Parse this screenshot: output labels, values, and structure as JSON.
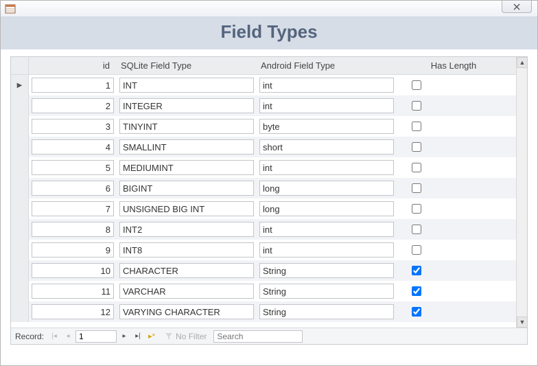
{
  "window": {
    "title": "Field Types"
  },
  "headers": {
    "id": "id",
    "sqlite": "SQLite Field Type",
    "android": "Android Field Type",
    "has_length": "Has Length"
  },
  "rows": [
    {
      "id": "1",
      "sqlite": "INT",
      "android": "int",
      "has_length": false
    },
    {
      "id": "2",
      "sqlite": "INTEGER",
      "android": "int",
      "has_length": false
    },
    {
      "id": "3",
      "sqlite": "TINYINT",
      "android": "byte",
      "has_length": false
    },
    {
      "id": "4",
      "sqlite": "SMALLINT",
      "android": "short",
      "has_length": false
    },
    {
      "id": "5",
      "sqlite": "MEDIUMINT",
      "android": "int",
      "has_length": false
    },
    {
      "id": "6",
      "sqlite": "BIGINT",
      "android": "long",
      "has_length": false
    },
    {
      "id": "7",
      "sqlite": "UNSIGNED BIG INT",
      "android": "long",
      "has_length": false
    },
    {
      "id": "8",
      "sqlite": "INT2",
      "android": "int",
      "has_length": false
    },
    {
      "id": "9",
      "sqlite": "INT8",
      "android": "int",
      "has_length": false
    },
    {
      "id": "10",
      "sqlite": "CHARACTER",
      "android": "String",
      "has_length": true
    },
    {
      "id": "11",
      "sqlite": "VARCHAR",
      "android": "String",
      "has_length": true
    },
    {
      "id": "12",
      "sqlite": "VARYING CHARACTER",
      "android": "String",
      "has_length": true
    }
  ],
  "nav": {
    "label": "Record:",
    "current": "1",
    "filter_label": "No Filter",
    "search_placeholder": "Search"
  }
}
